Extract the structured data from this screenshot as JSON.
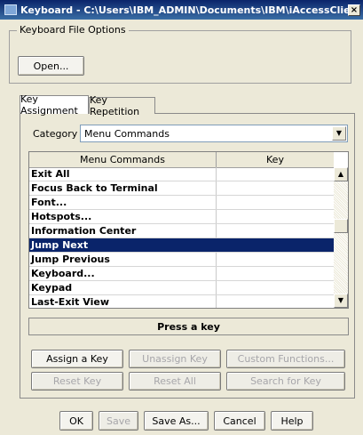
{
  "window": {
    "title": "Keyboard - C:\\Users\\IBM_ADMIN\\Documents\\IBM\\iAccessClient\\Emul...",
    "close": "×"
  },
  "keyboard_file_options": {
    "legend": "Keyboard File Options",
    "open_label": "Open..."
  },
  "tabs": [
    {
      "label": "Key Assignment",
      "active": true
    },
    {
      "label": "Key Repetition",
      "active": false
    }
  ],
  "category": {
    "label": "Category",
    "value": "Menu Commands",
    "arrow": "▼"
  },
  "table": {
    "columns": [
      "Menu Commands",
      "Key"
    ],
    "rows": [
      {
        "command": "Exit All",
        "key": ""
      },
      {
        "command": "Focus Back to Terminal",
        "key": ""
      },
      {
        "command": "Font...",
        "key": ""
      },
      {
        "command": "Hotspots...",
        "key": ""
      },
      {
        "command": "Information Center",
        "key": ""
      },
      {
        "command": "Jump Next",
        "key": "",
        "selected": true
      },
      {
        "command": "Jump Previous",
        "key": ""
      },
      {
        "command": "Keyboard...",
        "key": ""
      },
      {
        "command": "Keypad",
        "key": ""
      },
      {
        "command": "Last-Exit View",
        "key": ""
      }
    ],
    "scroll_up": "▲",
    "scroll_down": "▼"
  },
  "press_key": "Press a key",
  "action_buttons": {
    "assign_key": "Assign a Key",
    "unassign_key": "Unassign Key",
    "custom_functions": "Custom Functions...",
    "reset_key": "Reset Key",
    "reset_all": "Reset All",
    "search_for_key": "Search for Key"
  },
  "dialog_buttons": {
    "ok": "OK",
    "save": "Save",
    "save_as": "Save As...",
    "cancel": "Cancel",
    "help": "Help"
  }
}
